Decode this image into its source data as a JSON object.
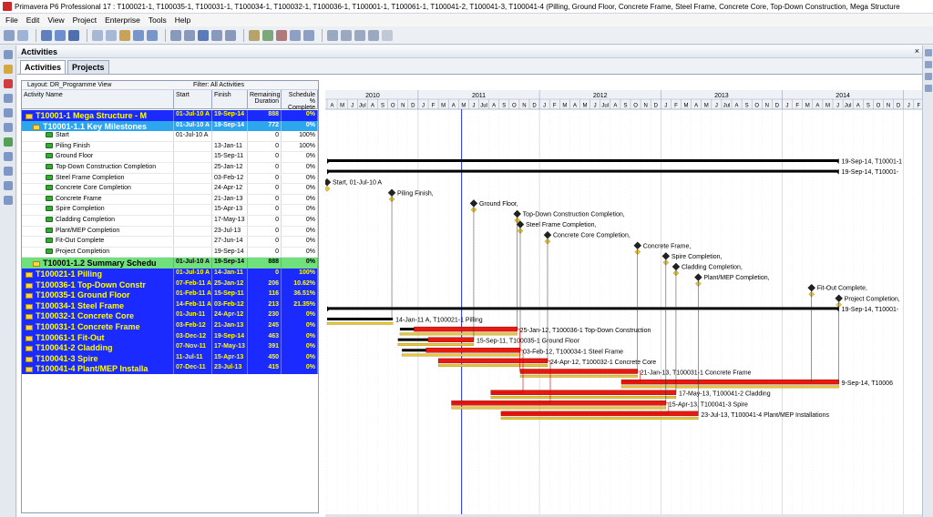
{
  "window": {
    "title": "Primavera P6 Professional 17 : T100021-1, T100035-1, T100031-1, T100034-1, T100032-1, T100036-1, T100001-1, T100061-1, T100041-2, T100041-3, T100041-4 (Pilling, Ground Floor, Concrete Frame, Steel Frame, Concrete Core, Top-Down Construction, Mega Structure"
  },
  "menu": [
    "File",
    "Edit",
    "View",
    "Project",
    "Enterprise",
    "Tools",
    "Help"
  ],
  "panel": {
    "title": "Activities",
    "close": "×"
  },
  "tabs": [
    {
      "label": "Activities",
      "active": true
    },
    {
      "label": "Projects",
      "active": false
    }
  ],
  "layout_label": "Layout: DR_Programme View",
  "filter_label": "Filter: All Activities",
  "columns": {
    "name": "Activity Name",
    "start": "Start",
    "finish": "Finish",
    "remaining": "Remaining Duration",
    "complete": "Schedule % Complete"
  },
  "rows": [
    {
      "type": "wbs1",
      "name": "T10001-1  Mega Structure - M",
      "start": "01-Jul-10 A",
      "finish": "19-Sep-14",
      "remaining": "888",
      "complete": "0%"
    },
    {
      "type": "wbs2",
      "name": "T10001-1.1  Key Milestones",
      "start": "01-Jul-10 A",
      "finish": "19-Sep-14",
      "remaining": "772",
      "complete": "0%"
    },
    {
      "type": "act",
      "name": "Start",
      "start": "01-Jul-10 A",
      "finish": "",
      "remaining": "0",
      "complete": "100%"
    },
    {
      "type": "act",
      "name": "Piling Finish",
      "start": "",
      "finish": "13-Jan-11",
      "remaining": "0",
      "complete": "100%"
    },
    {
      "type": "act",
      "name": "Ground Floor",
      "start": "",
      "finish": "15-Sep-11",
      "remaining": "0",
      "complete": "0%"
    },
    {
      "type": "act",
      "name": "Top-Down Construction Completion",
      "start": "",
      "finish": "25-Jan-12",
      "remaining": "0",
      "complete": "0%"
    },
    {
      "type": "act",
      "name": "Steel Frame Completion",
      "start": "",
      "finish": "03-Feb-12",
      "remaining": "0",
      "complete": "0%"
    },
    {
      "type": "act",
      "name": "Concrete Core Completion",
      "start": "",
      "finish": "24-Apr-12",
      "remaining": "0",
      "complete": "0%"
    },
    {
      "type": "act",
      "name": "Concrete Frame",
      "start": "",
      "finish": "21-Jan-13",
      "remaining": "0",
      "complete": "0%"
    },
    {
      "type": "act",
      "name": "Spire Completion",
      "start": "",
      "finish": "15-Apr-13",
      "remaining": "0",
      "complete": "0%"
    },
    {
      "type": "act",
      "name": "Cladding Completion",
      "start": "",
      "finish": "17-May-13",
      "remaining": "0",
      "complete": "0%"
    },
    {
      "type": "act",
      "name": "Plant/MEP Completion",
      "start": "",
      "finish": "23-Jul-13",
      "remaining": "0",
      "complete": "0%"
    },
    {
      "type": "act",
      "name": "Fit-Out Complete",
      "start": "",
      "finish": "27-Jun-14",
      "remaining": "0",
      "complete": "0%"
    },
    {
      "type": "act",
      "name": "Project Completion",
      "start": "",
      "finish": "19-Sep-14",
      "remaining": "0",
      "complete": "0%"
    },
    {
      "type": "wbs3",
      "name": "T10001-1.2  Summary Schedu",
      "start": "01-Jul-10 A",
      "finish": "19-Sep-14",
      "remaining": "888",
      "complete": "0%"
    },
    {
      "type": "wbs1",
      "name": "T100021-1  Pilling",
      "start": "01-Jul-10 A",
      "finish": "14-Jan-11",
      "remaining": "0",
      "complete": "100%"
    },
    {
      "type": "wbs1",
      "name": "T100036-1  Top-Down Constr",
      "start": "07-Feb-11 A",
      "finish": "25-Jan-12",
      "remaining": "206",
      "complete": "10.62%"
    },
    {
      "type": "wbs1",
      "name": "T100035-1  Ground Floor",
      "start": "01-Feb-11 A",
      "finish": "15-Sep-11",
      "remaining": "116",
      "complete": "36.51%"
    },
    {
      "type": "wbs1",
      "name": "T100034-1  Steel Frame",
      "start": "14-Feb-11 A",
      "finish": "03-Feb-12",
      "remaining": "213",
      "complete": "21.35%"
    },
    {
      "type": "wbs1",
      "name": "T100032-1  Concrete Core",
      "start": "01-Jun-11",
      "finish": "24-Apr-12",
      "remaining": "230",
      "complete": "0%"
    },
    {
      "type": "wbs1",
      "name": "T100031-1  Concrete Frame",
      "start": "03-Feb-12",
      "finish": "21-Jan-13",
      "remaining": "245",
      "complete": "0%"
    },
    {
      "type": "wbs1",
      "name": "T100061-1  Fit-Out",
      "start": "03-Dec-12",
      "finish": "19-Sep-14",
      "remaining": "463",
      "complete": "0%"
    },
    {
      "type": "wbs1",
      "name": "T100041-2  Cladding",
      "start": "07-Nov-11",
      "finish": "17-May-13",
      "remaining": "391",
      "complete": "0%"
    },
    {
      "type": "wbs1",
      "name": "T100041-3  Spire",
      "start": "11-Jul-11",
      "finish": "15-Apr-13",
      "remaining": "450",
      "complete": "0%"
    },
    {
      "type": "wbs1",
      "name": "T100041-4  Plant/MEP Installa",
      "start": "07-Dec-11",
      "finish": "23-Jul-13",
      "remaining": "415",
      "complete": "0%"
    }
  ],
  "gantt": {
    "years": [
      "2010",
      "2011",
      "2012",
      "2013",
      "2014"
    ],
    "months": [
      "A",
      "M",
      "J",
      "Jul",
      "A",
      "S",
      "O",
      "N",
      "D",
      "J",
      "F",
      "M",
      "A",
      "M",
      "J",
      "Jul",
      "A",
      "S",
      "O",
      "N",
      "D",
      "J",
      "F",
      "M",
      "A",
      "M",
      "J",
      "Jul",
      "A",
      "S",
      "O",
      "N",
      "D",
      "J",
      "F",
      "M",
      "A",
      "M",
      "J",
      "Jul",
      "A",
      "S",
      "O",
      "N",
      "D",
      "J",
      "F",
      "M",
      "A",
      "M",
      "J",
      "Jul",
      "A",
      "S",
      "O",
      "N",
      "D",
      "J",
      "F"
    ],
    "month_first_index": 3,
    "data_date_month_offset": 13.3,
    "bars": [
      {
        "row": 0,
        "kind": "summary",
        "start": 0,
        "end": 50.6,
        "label": "19-Sep-14, T10001-1"
      },
      {
        "row": 1,
        "kind": "summary",
        "start": 0,
        "end": 50.6,
        "label": "19-Sep-14, T10001-"
      },
      {
        "row": 2,
        "kind": "milestone",
        "at": 0,
        "label": "Start, 01-Jul-10 A"
      },
      {
        "row": 3,
        "kind": "milestone",
        "at": 6.4,
        "label": "Piling Finish,"
      },
      {
        "row": 4,
        "kind": "milestone",
        "at": 14.5,
        "label": "Ground Floor,"
      },
      {
        "row": 5,
        "kind": "milestone",
        "at": 18.8,
        "label": "Top-Down Construction Completion,"
      },
      {
        "row": 6,
        "kind": "milestone",
        "at": 19.1,
        "label": "Steel Frame Completion,"
      },
      {
        "row": 7,
        "kind": "milestone",
        "at": 21.8,
        "label": "Concrete Core Completion,"
      },
      {
        "row": 8,
        "kind": "milestone",
        "at": 30.7,
        "label": "Concrete Frame,"
      },
      {
        "row": 9,
        "kind": "milestone",
        "at": 33.5,
        "label": "Spire Completion,"
      },
      {
        "row": 10,
        "kind": "milestone",
        "at": 34.5,
        "label": "Cladding Completion,"
      },
      {
        "row": 11,
        "kind": "milestone",
        "at": 36.7,
        "label": "Plant/MEP Completion,"
      },
      {
        "row": 12,
        "kind": "milestone",
        "at": 47.9,
        "label": "Fit-Out Complete,"
      },
      {
        "row": 13,
        "kind": "milestone",
        "at": 50.6,
        "label": "Project Completion,"
      },
      {
        "row": 14,
        "kind": "summary",
        "start": 0,
        "end": 50.6,
        "label": "19-Sep-14, T10001-"
      },
      {
        "row": 15,
        "kind": "done",
        "start": 0,
        "end": 6.5,
        "label": "14-Jan-11 A, T100021-1  Pilling"
      },
      {
        "row": 16,
        "kind": "task",
        "start": 7.2,
        "progress": 8.6,
        "end": 18.8,
        "label": "25-Jan-12, T100036-1  Top-Down Construction"
      },
      {
        "row": 17,
        "kind": "task",
        "start": 7.0,
        "progress": 10.0,
        "end": 14.5,
        "label": "15-Sep-11, T100035-1  Ground Floor"
      },
      {
        "row": 18,
        "kind": "task",
        "start": 7.4,
        "progress": 9.8,
        "end": 19.1,
        "label": "03-Feb-12, T100034-1  Steel Frame"
      },
      {
        "row": 19,
        "kind": "task",
        "start": 11.0,
        "progress": 11.0,
        "end": 21.8,
        "label": "24-Apr-12, T100032-1  Concrete Core"
      },
      {
        "row": 20,
        "kind": "task",
        "start": 19.1,
        "progress": 19.1,
        "end": 30.7,
        "label": "21-Jan-13, T100031-1  Concrete Frame"
      },
      {
        "row": 21,
        "kind": "task",
        "start": 29.1,
        "progress": 29.1,
        "end": 50.6,
        "label": "9-Sep-14, T10006"
      },
      {
        "row": 22,
        "kind": "task",
        "start": 16.2,
        "progress": 16.2,
        "end": 34.5,
        "label": "17-May-13, T100041-2  Cladding"
      },
      {
        "row": 23,
        "kind": "task",
        "start": 12.3,
        "progress": 12.3,
        "end": 33.5,
        "label": "15-Apr-13, T100041-3  Spire"
      },
      {
        "row": 24,
        "kind": "task",
        "start": 17.2,
        "progress": 17.2,
        "end": 36.7,
        "label": "23-Jul-13, T100041-4  Plant/MEP Installations"
      }
    ]
  },
  "colors": {
    "wbs_blue": "#1b2bff",
    "wbs_text": "#ffff00",
    "milestone_wbs": "#2ea6ee",
    "summary_wbs": "#6fe07c",
    "bar_remaining": "#e8190f",
    "bar_baseline": "#e8c63a",
    "bar_summary": "#000000",
    "data_date": "#1f2fd6"
  }
}
